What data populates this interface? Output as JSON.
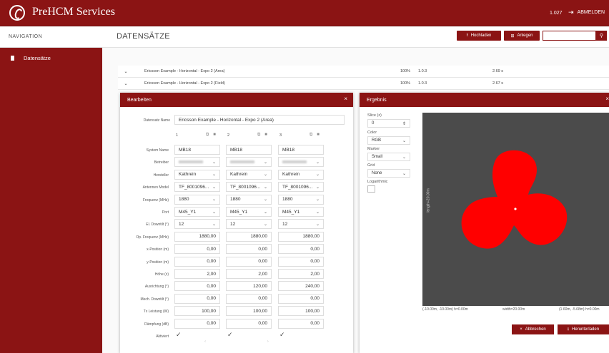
{
  "app": {
    "title": "PreHCM Services",
    "version": "1.027",
    "logout_label": "ABMELDEN"
  },
  "sidebar": {
    "heading": "NAVIGATION",
    "items": [
      {
        "label": "Datensätze"
      }
    ]
  },
  "main": {
    "title": "DATENSÄTZE",
    "upload_label": "Hochladen",
    "create_label": "Anlegen",
    "search_placeholder": "",
    "rows": [
      {
        "name": "Ericsson Example - Horizontal - Expo 2 (Area)",
        "pct": "100%",
        "ver": "1.0.3",
        "time": "2.69 s"
      },
      {
        "name": "Ericsson Example - Horizontal - Expo 2 (Field)",
        "pct": "100%",
        "ver": "1.0.3",
        "time": "2.67 s"
      }
    ]
  },
  "edit": {
    "title": "Bearbeiten",
    "name_label": "Datensatz Name",
    "name_value": "Ericsson Example - Horizontal - Expo 2 (Area)",
    "columns": [
      "1",
      "2",
      "3"
    ],
    "labels": [
      "System Name",
      "Betreiber",
      "Hersteller",
      "Antennen Model",
      "Frequenz (MHz)",
      "Port",
      "El. Downtilt (°)",
      "Op. Frequenz (MHz)",
      "x-Position (m)",
      "y-Position (m)",
      "Höhe (z)",
      "Ausrichtung (°)",
      "Mech. Downtilt (°)",
      "Tx Leistung (W)",
      "Dämpfung (dB)",
      "Aktiviert"
    ],
    "values": [
      [
        "MB18",
        "MB18",
        "MB18"
      ],
      [
        "",
        "",
        ""
      ],
      [
        "Kathrein",
        "Kathrein",
        "Kathrein"
      ],
      [
        "TF_8001096...",
        "TF_8001096...",
        "TF_8001096..."
      ],
      [
        "1880",
        "1880",
        "1880"
      ],
      [
        "M45_Y1",
        "M45_Y1",
        "M45_Y1"
      ],
      [
        "12",
        "12",
        "12"
      ],
      [
        "1880,00",
        "1880,00",
        "1880,00"
      ],
      [
        "0,00",
        "0,00",
        "0,00"
      ],
      [
        "0,00",
        "0,00",
        "0,00"
      ],
      [
        "2,00",
        "2,00",
        "2,00"
      ],
      [
        "0,00",
        "120,00",
        "240,00"
      ],
      [
        "0,00",
        "0,00",
        "0,00"
      ],
      [
        "100,00",
        "100,00",
        "100,00"
      ],
      [
        "0,00",
        "0,00",
        "0,00"
      ]
    ],
    "check_glyph": "✓"
  },
  "result": {
    "title": "Ergebnis",
    "slice_label": "Slice (z)",
    "slice_value": "0",
    "color_label": "Color",
    "color_value": "RGB",
    "marker_label": "Marker",
    "marker_value": "Small",
    "grid_label": "Grid",
    "grid_value": "None",
    "log_label": "Logarithmic",
    "left_axis": "length=20.00m",
    "bottom_left": "(-10.00m, -10.00m) h=0.00m",
    "bottom_mid": "width=20.00m",
    "bottom_right": "(1.60m, -5.68m) h=0.00m",
    "cancel_label": "Abbrechen",
    "download_label": "Herunterladen",
    "colors": {
      "plot_bg": "#4b4b4b",
      "field": "#ff0000"
    }
  }
}
